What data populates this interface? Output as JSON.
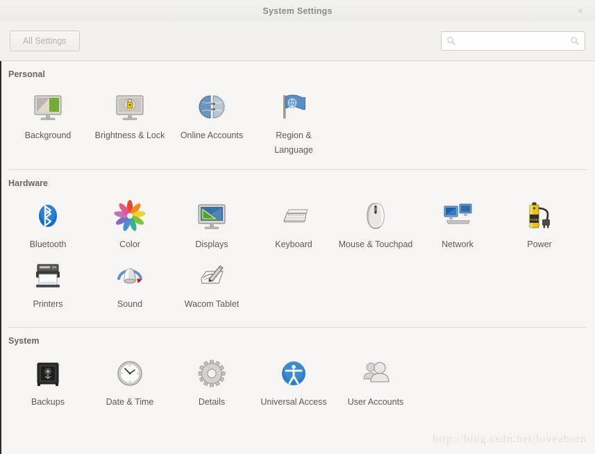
{
  "window": {
    "title": "System Settings",
    "close_label": "×"
  },
  "toolbar": {
    "all_settings_label": "All Settings",
    "search_value": "",
    "search_placeholder": ""
  },
  "colors": {
    "background": "#f6f5f4",
    "titlebar": "#f2f1f0",
    "label_text": "#5a5a5a",
    "section_title": "#666666",
    "divider": "#dddad6",
    "accent_blue": "#3a7fc4",
    "accent_green": "#4e9a06",
    "accent_yellow": "#e8c31e",
    "accent_red": "#cc0000"
  },
  "watermark": "http://blog.csdn.net/loveaborn",
  "sections": [
    {
      "id": "personal",
      "title": "Personal",
      "items": [
        {
          "label": "Background",
          "icon": "background-icon"
        },
        {
          "label": "Brightness & Lock",
          "icon": "brightness-lock-icon"
        },
        {
          "label": "Online Accounts",
          "icon": "online-accounts-icon"
        },
        {
          "label": "Region & Language",
          "icon": "region-language-icon"
        }
      ]
    },
    {
      "id": "hardware",
      "title": "Hardware",
      "items": [
        {
          "label": "Bluetooth",
          "icon": "bluetooth-icon"
        },
        {
          "label": "Color",
          "icon": "color-icon"
        },
        {
          "label": "Displays",
          "icon": "displays-icon"
        },
        {
          "label": "Keyboard",
          "icon": "keyboard-icon"
        },
        {
          "label": "Mouse & Touchpad",
          "icon": "mouse-touchpad-icon"
        },
        {
          "label": "Network",
          "icon": "network-icon"
        },
        {
          "label": "Power",
          "icon": "power-icon"
        },
        {
          "label": "Printers",
          "icon": "printers-icon"
        },
        {
          "label": "Sound",
          "icon": "sound-icon"
        },
        {
          "label": "Wacom Tablet",
          "icon": "wacom-tablet-icon"
        }
      ]
    },
    {
      "id": "system",
      "title": "System",
      "items": [
        {
          "label": "Backups",
          "icon": "backups-icon"
        },
        {
          "label": "Date & Time",
          "icon": "date-time-icon"
        },
        {
          "label": "Details",
          "icon": "details-icon"
        },
        {
          "label": "Universal Access",
          "icon": "universal-access-icon"
        },
        {
          "label": "User Accounts",
          "icon": "user-accounts-icon"
        }
      ]
    }
  ]
}
